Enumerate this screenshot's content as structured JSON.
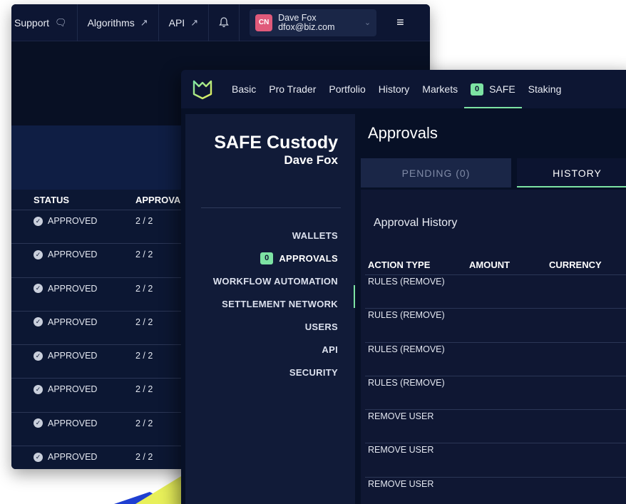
{
  "back_window": {
    "nav": [
      {
        "label": "Support",
        "icon": "chat-icon"
      },
      {
        "label": "Algorithms",
        "icon": "external-link-icon"
      },
      {
        "label": "API",
        "icon": "external-link-icon"
      }
    ],
    "user": {
      "initials": "CN",
      "name": "Dave Fox",
      "email": "dfox@biz.com"
    },
    "table": {
      "headers": [
        "STATUS",
        "APPROVAL"
      ],
      "rows": [
        {
          "status": "APPROVED",
          "approvals": "2 / 2"
        },
        {
          "status": "APPROVED",
          "approvals": "2 / 2"
        },
        {
          "status": "APPROVED",
          "approvals": "2 / 2"
        },
        {
          "status": "APPROVED",
          "approvals": "2 / 2"
        },
        {
          "status": "APPROVED",
          "approvals": "2 / 2"
        },
        {
          "status": "APPROVED",
          "approvals": "2 / 2"
        },
        {
          "status": "APPROVED",
          "approvals": "2 / 2"
        },
        {
          "status": "APPROVED",
          "approvals": "2 / 2"
        }
      ]
    }
  },
  "front_window": {
    "nav": {
      "tabs": [
        "Basic",
        "Pro Trader",
        "Portfolio",
        "History",
        "Markets"
      ],
      "safe": {
        "count": "0",
        "label": "SAFE"
      },
      "staking": "Staking"
    },
    "sidebar": {
      "title": "SAFE Custody",
      "subtitle": "Dave Fox",
      "menu": {
        "wallets": "WALLETS",
        "approvals_count": "0",
        "approvals": "APPROVALS",
        "workflow": "WORKFLOW AUTOMATION",
        "settlement": "SETTLEMENT NETWORK",
        "users": "USERS",
        "api": "API",
        "security": "SECURITY"
      }
    },
    "main": {
      "title": "Approvals",
      "tabs": {
        "pending": "PENDING (0)",
        "history": "HISTORY"
      },
      "panel_title": "Approval History",
      "table": {
        "headers": [
          "ACTION TYPE",
          "AMOUNT",
          "CURRENCY"
        ],
        "rows": [
          "RULES (REMOVE)",
          "RULES (REMOVE)",
          "RULES (REMOVE)",
          "RULES (REMOVE)",
          "REMOVE USER",
          "REMOVE USER",
          "REMOVE USER"
        ]
      }
    }
  },
  "colors": {
    "accent": "#7de3a3",
    "navy": "#0d1633",
    "avatar": "#e05a7a"
  }
}
